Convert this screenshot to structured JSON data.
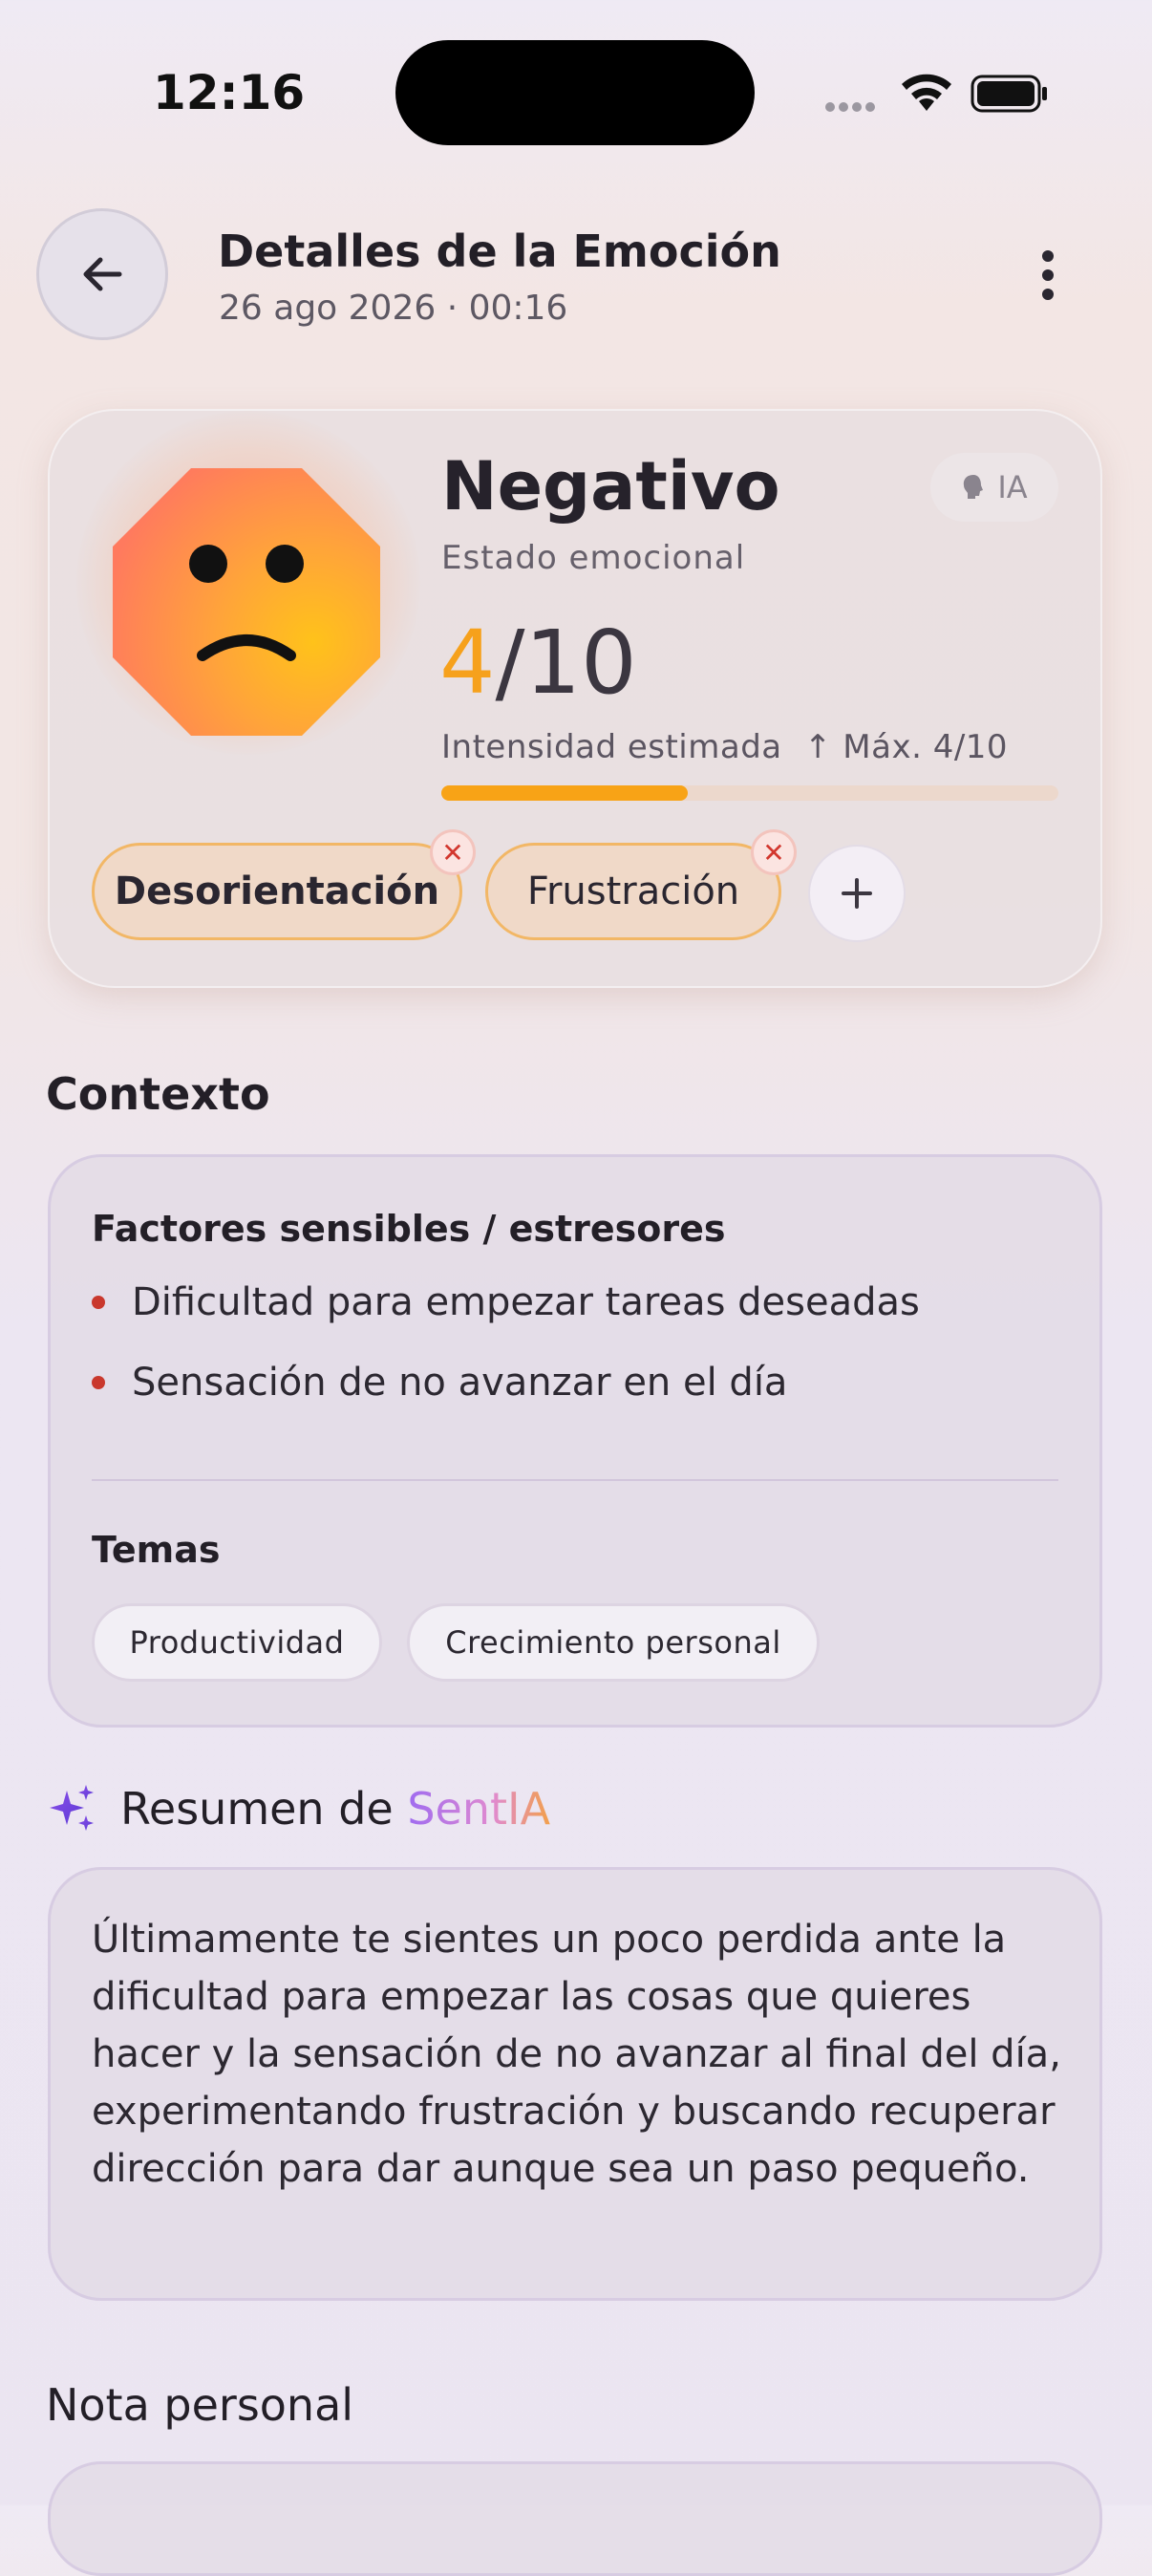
{
  "status_bar": {
    "time": "12:16"
  },
  "header": {
    "title": "Detalles de la Emoción",
    "subtitle": "26 ago 2026 · 00:16",
    "back_icon": "arrow-left-icon",
    "more_icon": "more-vertical-icon"
  },
  "emotion": {
    "name": "Negativo",
    "label": "Estado emocional",
    "badge": "IA",
    "intensity_value": "4",
    "intensity_max": "/10",
    "intensity_label": "Intensidad estimada",
    "max_label": "↑ Máx. 4/10",
    "intensity_fraction": 0.4,
    "accent": "#f8a316",
    "chips": [
      "Desorientación",
      "Frustración"
    ],
    "add_icon": "plus-icon"
  },
  "context": {
    "section_title": "Contexto",
    "factors_title": "Factores sensibles / estresores",
    "factors": [
      "Dificultad para empezar tareas deseadas",
      "Sensación de no avanzar en el día"
    ],
    "themes_title": "Temas",
    "themes": [
      "Productividad",
      "Crecimiento personal"
    ]
  },
  "summary": {
    "title_prefix": "Resumen de ",
    "title_brand": "SentIA",
    "text": "Últimamente te sientes un poco perdida ante la dificultad para empezar las cosas que quieres hacer y la sensación de no avanzar al final del día, experimentando frustración y buscando recuperar dirección para dar aunque sea un paso pequeño."
  },
  "note": {
    "section_title": "Nota personal"
  }
}
